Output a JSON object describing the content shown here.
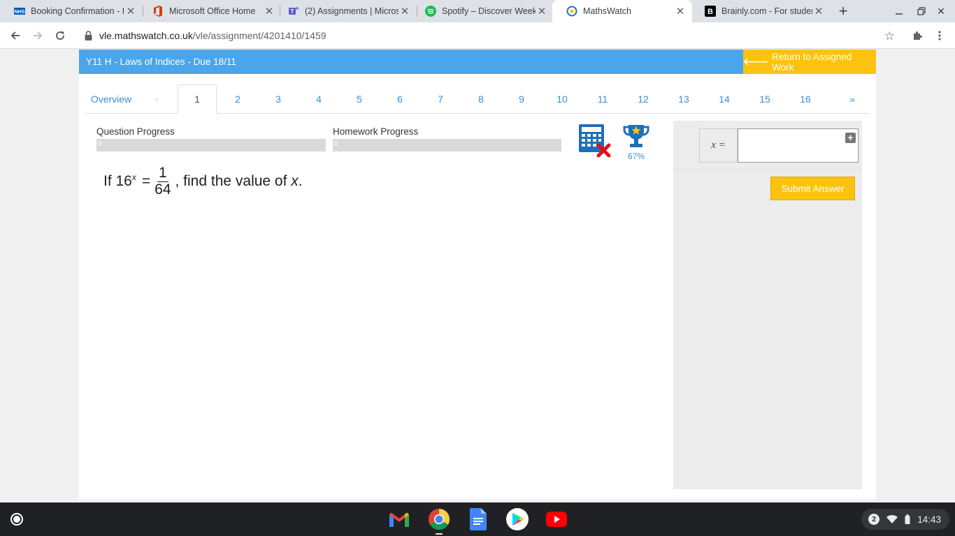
{
  "browser": {
    "tabs": [
      {
        "title": "Booking Confirmation - I",
        "icon": "nhs-icon"
      },
      {
        "title": "Microsoft Office Home",
        "icon": "office-icon"
      },
      {
        "title": "(2) Assignments | Micros",
        "icon": "teams-icon"
      },
      {
        "title": "Spotify – Discover Week",
        "icon": "spotify-icon"
      },
      {
        "title": "MathsWatch",
        "icon": "mathswatch-icon"
      },
      {
        "title": "Brainly.com - For studen",
        "icon": "brainly-icon"
      }
    ],
    "active_tab": 4,
    "url_domain": "vle.mathswatch.co.uk",
    "url_path": "/vle/assignment/4201410/1459"
  },
  "banner": {
    "title": "Y11 H - Laws of Indices - Due 18/11",
    "return_label": "Return to Assigned Work"
  },
  "question_tabs": {
    "overview": "Overview",
    "prev": "«",
    "numbers": [
      "1",
      "2",
      "3",
      "4",
      "5",
      "6",
      "7",
      "8",
      "9",
      "10",
      "11",
      "12",
      "13",
      "14",
      "15",
      "16"
    ],
    "next": "»",
    "active": "1"
  },
  "progress": {
    "question_label": "Question Progress",
    "question_value": "0",
    "homework_label": "Homework Progress",
    "homework_value": "0"
  },
  "trophy_percent": "67%",
  "question": {
    "prefix": "If 16",
    "exponent": "x",
    "equals": "=",
    "numerator": "1",
    "denominator": "64",
    "suffix": ", find the value of ",
    "variable": "x",
    "end": "."
  },
  "answer": {
    "label": "x =",
    "value": "",
    "submit_label": "Submit Answer"
  },
  "shelf": {
    "apps": [
      "gmail-icon",
      "chrome-icon",
      "docs-icon",
      "play-store-icon",
      "youtube-icon"
    ],
    "notification_count": "2",
    "time": "14:43"
  },
  "colors": {
    "banner": "#4aa5ea",
    "accent_yellow": "#fcc20f",
    "link_blue": "#3a8fd6"
  }
}
